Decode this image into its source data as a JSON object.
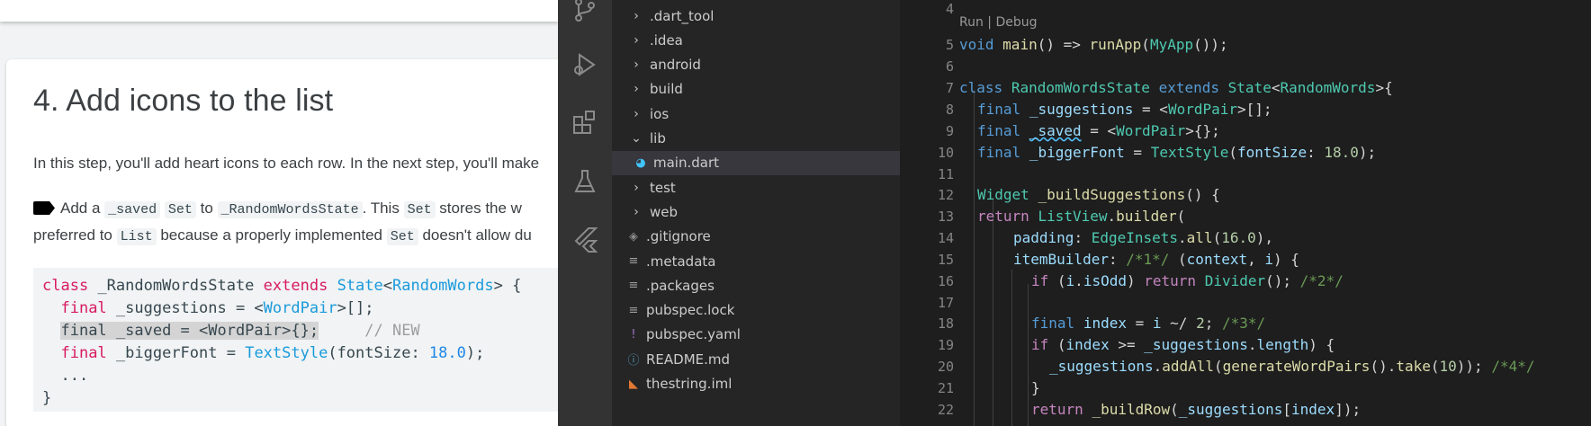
{
  "codelab": {
    "step_title": "4. Add icons to the list",
    "para1": "In this step, you'll add heart icons to each row. In the next step, you'll make",
    "para2": {
      "t1": "Add a ",
      "c1": "_saved",
      "t2": " ",
      "c2": "Set",
      "t3": " to ",
      "c3": "_RandomWordsState",
      "t4": ". This ",
      "c4": "Set",
      "t5": " stores the w"
    },
    "para3": {
      "t1": "preferred to ",
      "c1": "List",
      "t2": " because a properly implemented ",
      "c2": "Set",
      "t3": " doesn't allow du"
    },
    "code": {
      "l1_kw1": "class",
      "l1_a": " _RandomWordsState ",
      "l1_kw2": "extends",
      "l1_b": " ",
      "l1_t1": "State",
      "l1_c": "<",
      "l1_t2": "RandomWords",
      "l1_d": "> {",
      "l2_kw": "final",
      "l2_a": " _suggestions = <",
      "l2_t": "WordPair",
      "l2_b": ">[];",
      "l3_hl": "final _saved = <WordPair>{};",
      "l3_pad": "     ",
      "l3_cm": "// NEW",
      "l4_kw": "final",
      "l4_a": " _biggerFont = ",
      "l4_t": "TextStyle",
      "l4_b": "(fontSize: ",
      "l4_n": "18.0",
      "l4_c": ");",
      "l5": "...",
      "l6": "}"
    }
  },
  "vscode": {
    "activity": [
      "source-control-icon",
      "run-debug-icon",
      "extensions-icon",
      "testing-icon",
      "flutter-icon"
    ],
    "tree": [
      {
        "name": ".dart_tool",
        "kind": "folder",
        "open": false
      },
      {
        "name": ".idea",
        "kind": "folder",
        "open": false
      },
      {
        "name": "android",
        "kind": "folder",
        "open": false
      },
      {
        "name": "build",
        "kind": "folder",
        "open": false
      },
      {
        "name": "ios",
        "kind": "folder",
        "open": false
      },
      {
        "name": "lib",
        "kind": "folder",
        "open": true
      },
      {
        "name": "main.dart",
        "kind": "dart",
        "active": true
      },
      {
        "name": "test",
        "kind": "folder",
        "open": false
      },
      {
        "name": "web",
        "kind": "folder",
        "open": false
      },
      {
        "name": ".gitignore",
        "kind": "git"
      },
      {
        "name": ".metadata",
        "kind": "text"
      },
      {
        "name": ".packages",
        "kind": "text"
      },
      {
        "name": "pubspec.lock",
        "kind": "text"
      },
      {
        "name": "pubspec.yaml",
        "kind": "yaml"
      },
      {
        "name": "README.md",
        "kind": "info"
      },
      {
        "name": "thestring.iml",
        "kind": "rss"
      }
    ],
    "codelens": "Run | Debug",
    "line_numbers": [
      "4",
      "5",
      "6",
      "7",
      "8",
      "9",
      "10",
      "11",
      "12",
      "13",
      "14",
      "15",
      "16",
      "17",
      "18",
      "19",
      "20",
      "21",
      "22"
    ],
    "lines": {
      "l5": {
        "a": "void",
        "b": " ",
        "c": "main",
        "d": "() => ",
        "e": "runApp",
        "f": "(",
        "g": "MyApp",
        "h": "());"
      },
      "l7": {
        "a": "class",
        "b": " ",
        "c": "RandomWordsState",
        "d": " ",
        "e": "extends",
        "f": " ",
        "g": "State",
        "h": "<",
        "i": "RandomWords",
        "j": ">{"
      },
      "l8": {
        "a": "final",
        "b": " ",
        "c": "_suggestions",
        "d": " = <",
        "e": "WordPair",
        "f": ">[];"
      },
      "l9": {
        "a": "final",
        "b": " ",
        "c": "_saved",
        "d": " = <",
        "e": "WordPair",
        "f": ">{};"
      },
      "l10": {
        "a": "final",
        "b": " ",
        "c": "_biggerFont",
        "d": " = ",
        "e": "TextStyle",
        "f": "(",
        "g": "fontSize",
        "h": ": ",
        "i": "18.0",
        "j": ");"
      },
      "l12": {
        "a": "Widget",
        "b": " ",
        "c": "_buildSuggestions",
        "d": "() {"
      },
      "l13": {
        "a": "return",
        "b": " ",
        "c": "ListView",
        "d": ".",
        "e": "builder",
        "f": "("
      },
      "l14": {
        "a": "padding",
        "b": ": ",
        "c": "EdgeInsets",
        "d": ".",
        "e": "all",
        "f": "(",
        "g": "16.0",
        "h": "),"
      },
      "l15": {
        "a": "itemBuilder",
        "b": ": ",
        "c": "/*1*/",
        "d": " (",
        "e": "context",
        "f": ", ",
        "g": "i",
        "h": ") {"
      },
      "l16": {
        "a": "if",
        "b": " (",
        "c": "i",
        "d": ".",
        "e": "isOdd",
        "f": ") ",
        "g": "return",
        "h": " ",
        "i": "Divider",
        "j": "(); ",
        "k": "/*2*/"
      },
      "l18": {
        "a": "final",
        "b": " ",
        "c": "index",
        "d": " = ",
        "e": "i",
        "f": " ~/ ",
        "g": "2",
        "h": "; ",
        "i": "/*3*/"
      },
      "l19": {
        "a": "if",
        "b": " (",
        "c": "index",
        "d": " >= ",
        "e": "_suggestions",
        "f": ".",
        "g": "length",
        "h": ") {"
      },
      "l20": {
        "a": "_suggestions",
        "b": ".",
        "c": "addAll",
        "d": "(",
        "e": "generateWordPairs",
        "f": "().",
        "g": "take",
        "h": "(",
        "i": "10",
        "j": ")); ",
        "k": "/*4*/"
      },
      "l21": {
        "a": "}"
      },
      "l22": {
        "a": "return",
        "b": " ",
        "c": "_buildRow",
        "d": "(",
        "e": "_suggestions",
        "f": "[",
        "g": "index",
        "h": "]);"
      }
    }
  }
}
